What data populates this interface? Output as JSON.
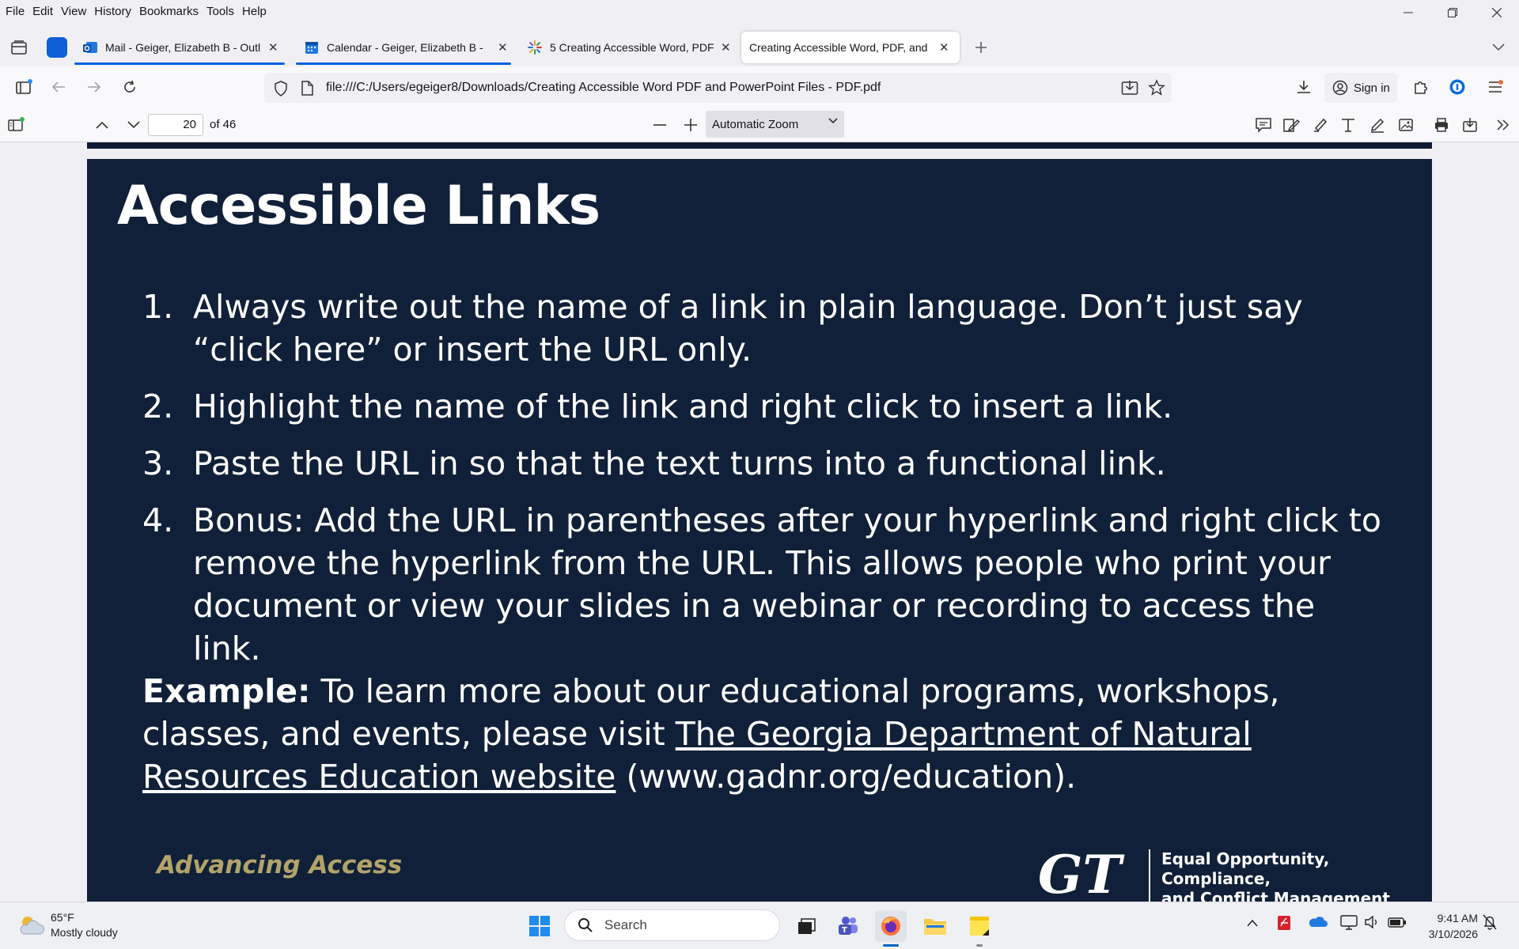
{
  "menu": {
    "items": [
      "File",
      "Edit",
      "View",
      "History",
      "Bookmarks",
      "Tools",
      "Help"
    ]
  },
  "tabs": [
    {
      "label": "Mail - Geiger, Elizabeth B - Outl",
      "icon": "outlook-icon"
    },
    {
      "label": "Calendar - Geiger, Elizabeth B -",
      "icon": "calendar-icon"
    },
    {
      "label": "5 Creating Accessible Word, PDF",
      "icon": "sparkle-icon"
    },
    {
      "label": "Creating Accessible Word, PDF, and",
      "icon": "none"
    }
  ],
  "navbar": {
    "url": "file:///C:/Users/egeiger8/Downloads/Creating Accessible Word PDF and PowerPoint Files - PDF.pdf",
    "sign_in": "Sign in"
  },
  "pdf_toolbar": {
    "page_number": "20",
    "page_total": "of 46",
    "zoom": "Automatic Zoom"
  },
  "slide": {
    "title": "Accessible Links",
    "items": [
      {
        "num": "1.",
        "text": "Always write out the name of a link in plain language. Don’t just say “click here” or insert the URL only."
      },
      {
        "num": "2.",
        "text": "Highlight the name of the link and right click to insert a link."
      },
      {
        "num": "3.",
        "text": "Paste the URL in so that the text turns into a functional link."
      },
      {
        "num": "4.",
        "text": "Bonus: Add the URL in parentheses after your hyperlink and right click to remove the hyperlink from the URL. This allows people who print your document or view your slides in a webinar or recording to access the link."
      }
    ],
    "example_label": "Example:",
    "example_text": " To learn more about our educational programs, workshops, classes, and events, please visit ",
    "example_link": "The Georgia Department of Natural Resources Education website",
    "example_suffix": " (www.gadnr.org/education).",
    "footer_left": "Advancing Access",
    "footer_logo": "GT",
    "footer_right_line1": "Equal Opportunity, Compliance,",
    "footer_right_line2": "and Conflict Management"
  },
  "taskbar": {
    "temperature": "65°F",
    "weather": "Mostly cloudy",
    "search": "Search",
    "time": "9:41 AM",
    "date": "3/10/2026"
  },
  "colors": {
    "slide_bg": "#102039",
    "accent_gold": "#b3a369",
    "tab_underline": "#0061e0"
  }
}
